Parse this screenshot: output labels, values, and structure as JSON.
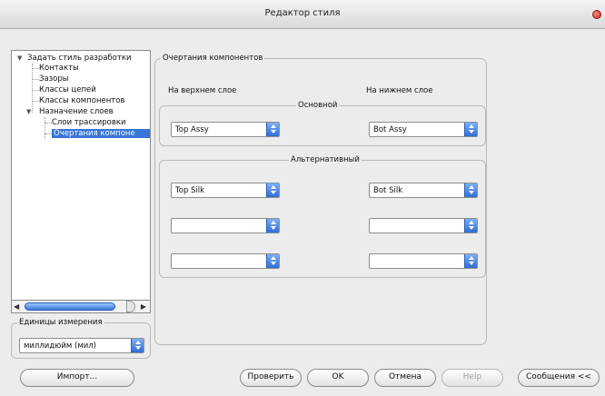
{
  "window": {
    "title": "Редактор стиля"
  },
  "tree": {
    "items": [
      {
        "label": "Задать стиль разработки"
      },
      {
        "label": "Контакты"
      },
      {
        "label": "Зазоры"
      },
      {
        "label": "Классы цепей"
      },
      {
        "label": "Классы компонентов"
      },
      {
        "label": "Назначение слоев"
      },
      {
        "label": "Слои трассировки"
      },
      {
        "label": "Очертания компоне"
      }
    ]
  },
  "units": {
    "legend": "Единицы измерения",
    "value": "миллидюйм (мил)"
  },
  "main": {
    "legend": "Очертания компонентов",
    "top_layer_label": "На верхнем слое",
    "bottom_layer_label": "На нижнем слое",
    "primary": {
      "legend": "Основной",
      "top_value": "Top Assy",
      "bottom_value": "Bot Assy"
    },
    "alternate": {
      "legend": "Альтернативный",
      "top_values": [
        "Top Silk",
        "",
        ""
      ],
      "bottom_values": [
        "Bot Silk",
        "",
        ""
      ]
    }
  },
  "buttons": {
    "import": "Импорт...",
    "check": "Проверить",
    "ok": "OK",
    "cancel": "Отмена",
    "help": "Help",
    "messages": "Сообщения <<"
  }
}
